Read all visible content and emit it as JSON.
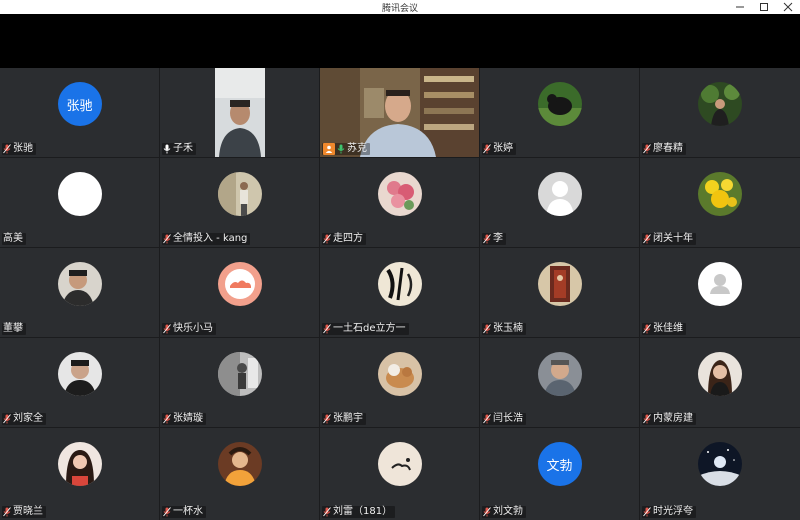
{
  "window": {
    "title": "腾讯会议",
    "minimize_icon": "minimize-icon",
    "maximize_icon": "maximize-icon",
    "close_icon": "close-icon"
  },
  "colors": {
    "grid_background": "#1b1c1e",
    "tile_background": "#2b2d30",
    "active_speaker_border": "#3ec46d",
    "muted_mic": "#e0564a",
    "live_mic": "#ffffff",
    "host_badge": "#f0882c",
    "text_avatar": "#1a73e8"
  },
  "participants": [
    {
      "name": "张驰",
      "avatar_text": "张驰",
      "mic": "muted"
    },
    {
      "name": "子禾",
      "mic": "on",
      "video": true
    },
    {
      "name": "苏克",
      "mic": "on",
      "video": true,
      "host": true,
      "speaking": true
    },
    {
      "name": "张婷",
      "mic": "muted"
    },
    {
      "name": "廖春精",
      "mic": "muted"
    },
    {
      "name": "高美",
      "mic": "none"
    },
    {
      "name": "全情投入 - kang",
      "mic": "muted"
    },
    {
      "name": "走四方",
      "mic": "muted"
    },
    {
      "name": "李",
      "mic": "muted"
    },
    {
      "name": "闭关十年",
      "mic": "muted"
    },
    {
      "name": "董攀",
      "mic": "none"
    },
    {
      "name": "快乐小马",
      "mic": "muted"
    },
    {
      "name": "一土石de立方一",
      "mic": "muted"
    },
    {
      "name": "张玉楠",
      "mic": "muted"
    },
    {
      "name": "张佳维",
      "mic": "muted"
    },
    {
      "name": "刘家全",
      "mic": "muted"
    },
    {
      "name": "张婧璇",
      "mic": "muted"
    },
    {
      "name": "张鹏宇",
      "mic": "muted"
    },
    {
      "name": "闫长浩",
      "mic": "muted"
    },
    {
      "name": "内蒙房建",
      "mic": "muted"
    },
    {
      "name": "贾晓兰",
      "mic": "muted"
    },
    {
      "name": "一杯水",
      "mic": "muted"
    },
    {
      "name": "刘雷（181）",
      "mic": "muted"
    },
    {
      "name": "刘文勃",
      "avatar_text": "文勃",
      "mic": "muted"
    },
    {
      "name": "时光浮夸",
      "mic": "muted"
    }
  ]
}
